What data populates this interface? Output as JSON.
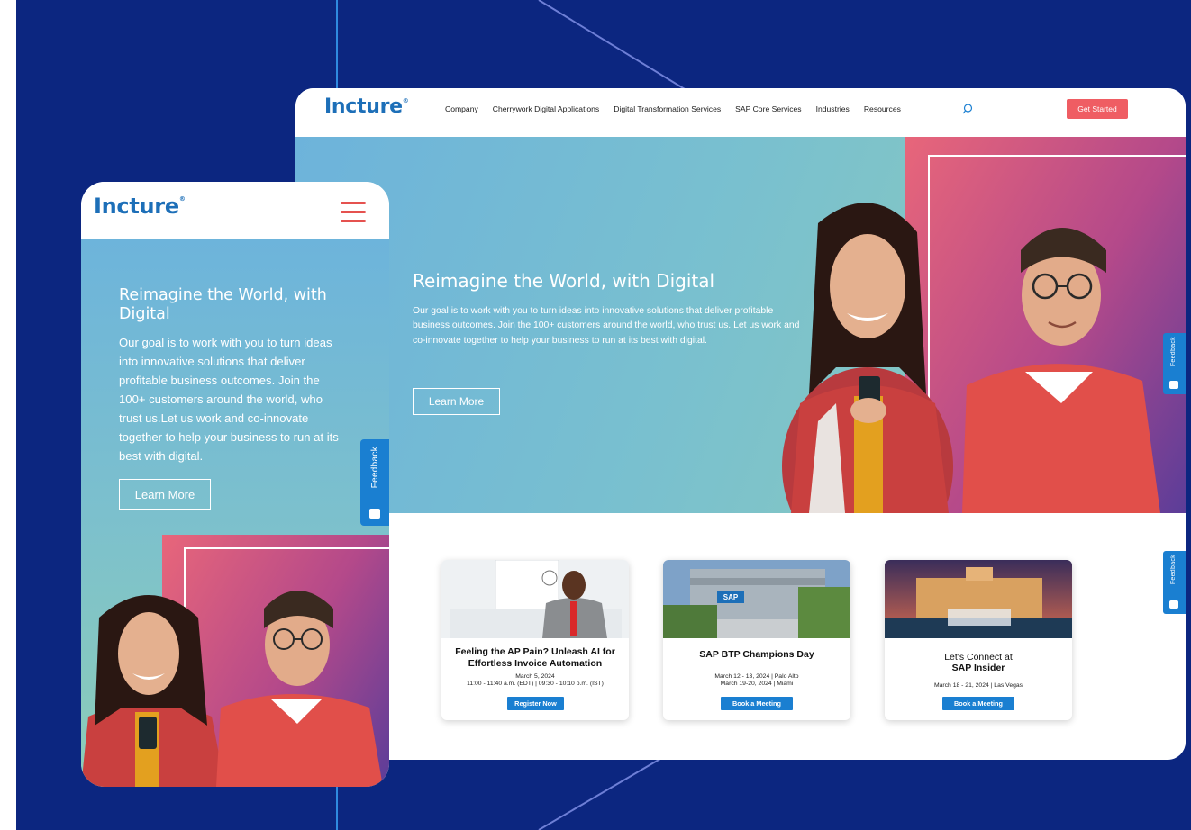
{
  "brand": {
    "logo_text": "Incture",
    "logo_mark": "®",
    "colors": {
      "background": "#0c2680",
      "logo": "#1d6fb8",
      "cta": "#ef5d63",
      "accent_blue": "#1a7fd1",
      "hero_gradient_start": "#6db3db",
      "hero_gradient_end": "#8fcdb7"
    }
  },
  "desktop": {
    "nav": {
      "items": [
        "Company",
        "Cherrywork Digital Applications",
        "Digital Transformation Services",
        "SAP Core Services",
        "Industries",
        "Resources"
      ],
      "search_icon": "search-icon",
      "cta_label": "Get Started"
    },
    "hero": {
      "title": "Reimagine the World, with Digital",
      "body": "Our goal is to work with you to turn ideas into innovative solutions that deliver profitable business outcomes. Join the 100+ customers around the world, who trust us. Let us work and co-innovate together to help your business to run at its best with digital.",
      "button_label": "Learn More"
    },
    "feedback_label": "Feedback",
    "events": [
      {
        "title": "Feeling the AP Pain? Unleash AI for Effortless Invoice Automation",
        "date": "March 5, 2024",
        "time": "11:00 - 11:40 a.m. (EDT) | 09:30 - 10:10 p.m. (IST)",
        "button_label": "Register Now"
      },
      {
        "title": "SAP BTP Champions Day",
        "line1": "March 12 - 13, 2024 | Palo Alto",
        "line2": "March 19-20, 2024 | Miami",
        "button_label": "Book a Meeting",
        "sign_text": "SAP"
      },
      {
        "title_prefix": "Let's Connect at",
        "title": "SAP Insider",
        "line1": "March 18 - 21, 2024 | Las Vegas",
        "button_label": "Book a Meeting"
      }
    ]
  },
  "mobile": {
    "hero": {
      "title": "Reimagine the World, with Digital",
      "body": "Our goal is to work with you to turn ideas into innovative solutions that deliver profitable business outcomes. Join the 100+ customers around the world, who trust us.Let us work and co-innovate together to help your business to run at its best with digital.",
      "button_label": "Learn More"
    },
    "menu_icon": "hamburger-menu-icon",
    "feedback_label": "Feedback"
  }
}
